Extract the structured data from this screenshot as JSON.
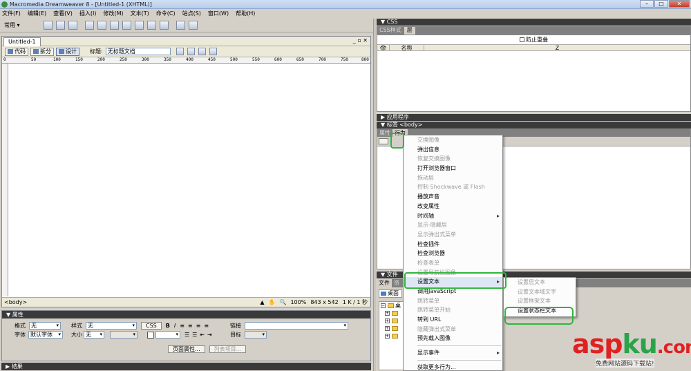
{
  "window": {
    "title": "Macromedia Dreamweaver 8 - [Untitled-1 (XHTML)]"
  },
  "menu": [
    "文件(F)",
    "编辑(E)",
    "查看(V)",
    "插入(I)",
    "修改(M)",
    "文本(T)",
    "命令(C)",
    "站点(S)",
    "窗口(W)",
    "帮助(H)"
  ],
  "insertbar": {
    "category": "常用"
  },
  "document": {
    "tab": "Untitled-1",
    "view_code": "代码",
    "view_split": "拆分",
    "view_design": "设计",
    "title_label": "标题:",
    "title_value": "无标题文档",
    "ruler_ticks": [
      "0",
      "50",
      "100",
      "150",
      "200",
      "250",
      "300",
      "350",
      "400",
      "450",
      "500",
      "550",
      "600",
      "650",
      "700",
      "750",
      "800"
    ],
    "status_tag": "<body>",
    "zoom": "100%",
    "size": "843 x 542",
    "download": "1 K / 1 秒"
  },
  "properties": {
    "header": "属性",
    "format_label": "格式",
    "format_value": "无",
    "style_label": "样式",
    "style_value": "无",
    "css_button": "CSS",
    "link_label": "链接",
    "font_label": "字体",
    "font_value": "默认字体",
    "size_label": "大小",
    "size_value": "无",
    "target_label": "目标",
    "page_props_button": "页面属性...",
    "list_item_button": "列表项目..."
  },
  "results": {
    "header": "结果"
  },
  "css_panel": {
    "header": "CSS",
    "tab_styles": "CSS样式",
    "tab_layers": "层",
    "prevent_overlap": "防止重叠",
    "col_name": "名称",
    "col_z": "Z"
  },
  "app_panel": {
    "header": "应用程序"
  },
  "tag_panel": {
    "header": "标签 <body>",
    "tab_attributes": "属性",
    "tab_behaviors": "行为"
  },
  "files_panel": {
    "header": "文件",
    "tab_files": "文件",
    "tab_assets": "资",
    "site_select": "桌面",
    "tree_root": "桌"
  },
  "context_menu": {
    "items": [
      {
        "label": "交换图像",
        "enabled": false
      },
      {
        "label": "弹出信息",
        "enabled": true
      },
      {
        "label": "恢复交换图像",
        "enabled": false
      },
      {
        "label": "打开浏览器窗口",
        "enabled": true
      },
      {
        "label": "拖动层",
        "enabled": false
      },
      {
        "label": "控制 Shockwave 或 Flash",
        "enabled": false
      },
      {
        "label": "播放声音",
        "enabled": true
      },
      {
        "label": "改变属性",
        "enabled": true
      },
      {
        "label": "时间轴",
        "enabled": true,
        "submenu": true
      },
      {
        "label": "显示-隐藏层",
        "enabled": false
      },
      {
        "label": "显示弹出式菜单",
        "enabled": false
      },
      {
        "label": "检查插件",
        "enabled": true
      },
      {
        "label": "检查浏览器",
        "enabled": true
      },
      {
        "label": "检查表单",
        "enabled": false
      },
      {
        "label": "设置导航栏图像",
        "enabled": false
      },
      {
        "label": "设置文本",
        "enabled": true,
        "submenu": true,
        "highlighted": true
      },
      {
        "label": "调用JavaScript",
        "enabled": true
      },
      {
        "label": "跳转菜单",
        "enabled": false
      },
      {
        "label": "跳转菜单开始",
        "enabled": false
      },
      {
        "label": "转到 URL",
        "enabled": true
      },
      {
        "label": "隐藏弹出式菜单",
        "enabled": false
      },
      {
        "label": "预先载入图像",
        "enabled": true
      },
      {
        "label": "显示事件",
        "enabled": true,
        "submenu": true,
        "separator_before": true
      },
      {
        "label": "获取更多行为...",
        "enabled": true,
        "separator_before": true
      }
    ]
  },
  "submenu": {
    "items": [
      {
        "label": "设置层文本",
        "enabled": false
      },
      {
        "label": "设置文本域文字",
        "enabled": false
      },
      {
        "label": "设置框架文本",
        "enabled": false
      },
      {
        "label": "设置状态栏文本",
        "enabled": true
      }
    ]
  },
  "watermark": {
    "brand_a": "asp",
    "brand_b": "ku",
    "brand_c": ".com",
    "tagline": "免费网站源码下载站!"
  },
  "colors": {
    "highlight": "#2fb53a",
    "panel_header": "#3a3a3a",
    "watermark_red": "#e02121",
    "watermark_green": "#2aa34a"
  }
}
